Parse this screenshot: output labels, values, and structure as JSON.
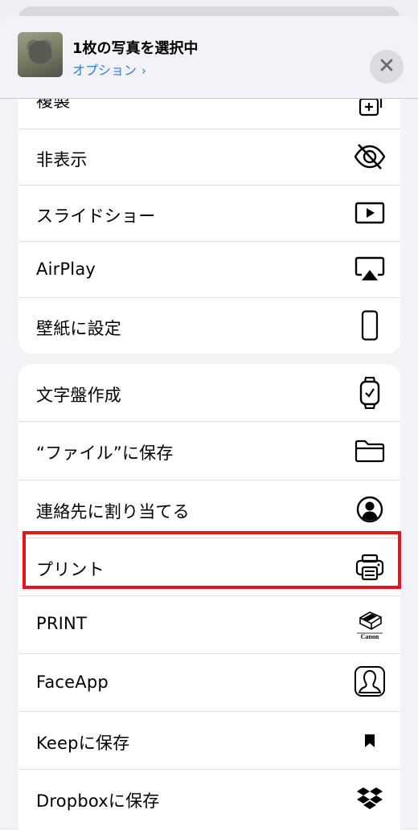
{
  "header": {
    "title": "1枚の写真を選択中",
    "options_label": "オプション",
    "options_chevron": "›"
  },
  "section1": {
    "items": [
      {
        "label": "複製",
        "icon": "duplicate-icon"
      },
      {
        "label": "非表示",
        "icon": "eye-slash-icon"
      },
      {
        "label": "スライドショー",
        "icon": "play-rectangle-icon"
      },
      {
        "label": "AirPlay",
        "icon": "airplay-icon"
      },
      {
        "label": "壁紙に設定",
        "icon": "iphone-icon"
      }
    ]
  },
  "section2": {
    "items": [
      {
        "label": "文字盤作成",
        "icon": "watch-icon"
      },
      {
        "label": "“ファイル”に保存",
        "icon": "folder-icon"
      },
      {
        "label": "連絡先に割り当てる",
        "icon": "person-circle-icon"
      },
      {
        "label": "プリント",
        "icon": "printer-icon"
      },
      {
        "label": "PRINT",
        "icon": "canon-print-app-icon",
        "icon_text": "Canon"
      },
      {
        "label": "FaceApp",
        "icon": "faceapp-icon"
      },
      {
        "label": "Keepに保存",
        "icon": "bookmark-icon"
      },
      {
        "label": "Dropboxに保存",
        "icon": "dropbox-icon"
      }
    ]
  },
  "colors": {
    "accent": "#2a7de1",
    "highlight_box": "#e8141c",
    "background": "#f2f2f7"
  }
}
